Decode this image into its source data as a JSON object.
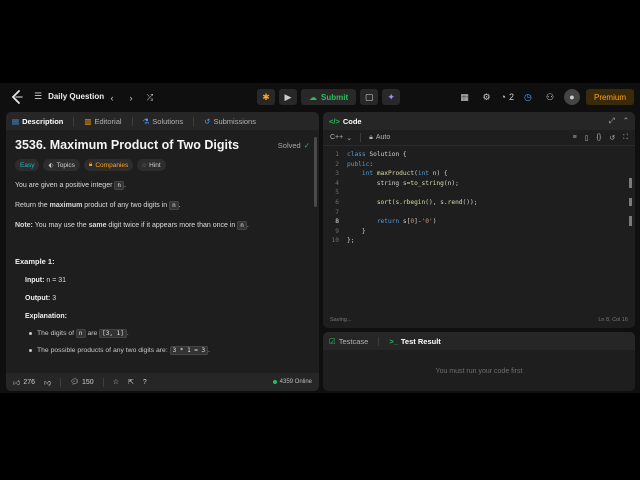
{
  "header": {
    "nav_label": "Daily Question",
    "submit_label": "Submit",
    "streak_count": "2",
    "premium_label": "Premium"
  },
  "description_panel": {
    "tabs": [
      {
        "label": "Description"
      },
      {
        "label": "Editorial"
      },
      {
        "label": "Solutions"
      },
      {
        "label": "Submissions"
      }
    ],
    "title": "3536. Maximum Product of Two Digits",
    "status": "Solved",
    "tags": [
      {
        "label": "Easy"
      },
      {
        "label": "Topics"
      },
      {
        "label": "Companies"
      },
      {
        "label": "Hint"
      }
    ],
    "p1_text": "You are given a positive integer",
    "p1_code": "n",
    "p2_pre": "Return the",
    "p2_bold": "maximum",
    "p2_post": "product of any two digits in",
    "p2_code": "n",
    "note_label": "Note:",
    "note_pre": "You may use the",
    "note_bold": "same",
    "note_post": "digit twice if it appears more than once in",
    "note_code": "n",
    "example_title": "Example 1:",
    "input_label": "Input:",
    "input_value": "n = 31",
    "output_label": "Output:",
    "output_value": "3",
    "explanation_label": "Explanation:",
    "bullet1_pre": "The digits of",
    "bullet1_code1": "n",
    "bullet1_mid": "are",
    "bullet1_code2": "[3, 1]",
    "bullet2_pre": "The possible products of any two digits are:",
    "bullet2_code": "3 * 1 = 3"
  },
  "footer": {
    "likes": "276",
    "comments": "150",
    "online": "4359 Online"
  },
  "code_panel": {
    "title": "Code",
    "language": "C++",
    "mode": "Auto",
    "lines": [
      "1",
      "2",
      "3",
      "4",
      "5",
      "6",
      "7",
      "8",
      "9",
      "10"
    ],
    "saving": "Saving...",
    "cursor_pos": "Ln 8, Col 16"
  },
  "result_panel": {
    "tabs": [
      {
        "label": "Testcase"
      },
      {
        "label": "Test Result"
      }
    ],
    "message": "You must run your code first"
  },
  "colors": {
    "accent_orange": "#ffa116",
    "accent_green": "#2cbb5d",
    "easy_teal": "#1cbaba",
    "panel_bg": "#1e1e1e"
  }
}
